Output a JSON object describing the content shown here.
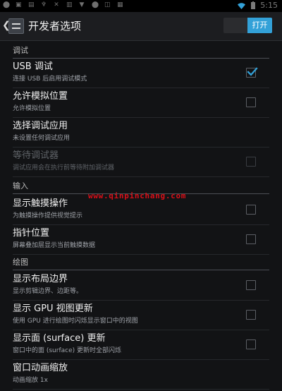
{
  "status_bar": {
    "notification_icons": [
      "android-icon",
      "image-icon",
      "apk-icon",
      "usb-icon",
      "tool-icon",
      "file-icon",
      "download-icon",
      "android-icon",
      "chat-icon",
      "settings-icon"
    ],
    "time": "5:15"
  },
  "header": {
    "back_icon": "chevron-left-icon",
    "app_icon": "settings-icon",
    "title": "开发者选项",
    "toggle": {
      "state": "打开"
    }
  },
  "sections": [
    {
      "title": "调试",
      "items": [
        {
          "title": "USB 调试",
          "summary": "连接 USB 后启用调试模式",
          "checked": true,
          "disabled": false
        },
        {
          "title": "允许模拟位置",
          "summary": "允许模拟位置",
          "checked": false,
          "disabled": false
        },
        {
          "title": "选择调试应用",
          "summary": "未设置任何调试应用",
          "checked": false,
          "disabled": false
        },
        {
          "title": "等待调试器",
          "summary": "调试应用会在执行前等待附加调试器",
          "checked": false,
          "disabled": true
        }
      ]
    },
    {
      "title": "输入",
      "items": [
        {
          "title": "显示触摸操作",
          "summary": "为触摸操作提供视觉提示",
          "checked": false,
          "disabled": false
        },
        {
          "title": "指针位置",
          "summary": "屏幕叠加层显示当前触摸数据",
          "checked": false,
          "disabled": false
        }
      ]
    },
    {
      "title": "绘图",
      "items": [
        {
          "title": "显示布局边界",
          "summary": "显示剪辑边界、边距等。",
          "checked": false,
          "disabled": false
        },
        {
          "title": "显示 GPU 视图更新",
          "summary": "使用 GPU 进行绘图时闪烁显示窗口中的视图",
          "checked": false,
          "disabled": false
        },
        {
          "title": "显示面 (surface) 更新",
          "summary": "窗口中的面 (surface) 更新时全部闪烁",
          "checked": false,
          "disabled": false
        },
        {
          "title": "窗口动画缩放",
          "summary": "动画缩放 1x",
          "checked": false,
          "disabled": false
        }
      ]
    }
  ],
  "watermark": "www.qinpinchang.com",
  "colors": {
    "accent": "#33a1d8",
    "background": "#121315",
    "watermark": "#d80f18"
  }
}
